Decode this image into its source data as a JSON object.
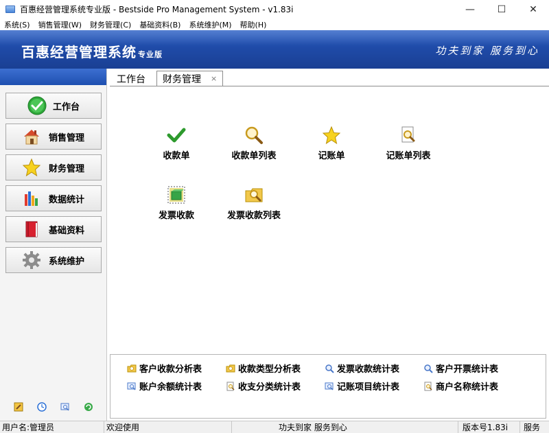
{
  "window": {
    "title": "百惠经营管理系统专业版 - Bestside Pro Management System - v1.83i",
    "minimize_glyph": "—",
    "maximize_glyph": "☐",
    "close_glyph": "✕"
  },
  "menu": [
    {
      "label": "系统(S)"
    },
    {
      "label": "销售管理(W)"
    },
    {
      "label": "财务管理(C)"
    },
    {
      "label": "基础资料(B)"
    },
    {
      "label": "系统维护(M)"
    },
    {
      "label": "帮助(H)"
    }
  ],
  "banner": {
    "brand": "百惠经营管理系统",
    "brand_sub": "专业版",
    "slogan": "功夫到家 服务到心"
  },
  "sidebar": {
    "items": [
      {
        "label": "工作台",
        "icon": "check-circle-icon",
        "active": true
      },
      {
        "label": "销售管理",
        "icon": "house-icon"
      },
      {
        "label": "财务管理",
        "icon": "star-icon"
      },
      {
        "label": "数据统计",
        "icon": "bar-chart-icon"
      },
      {
        "label": "基础资料",
        "icon": "book-icon"
      },
      {
        "label": "系统维护",
        "icon": "gear-icon"
      }
    ],
    "tools": [
      "edit-icon",
      "clock-icon",
      "search-window-icon",
      "refresh-icon"
    ]
  },
  "tabs": [
    {
      "label": "工作台"
    },
    {
      "label": "财务管理",
      "active": true,
      "close": "×"
    }
  ],
  "tiles": [
    {
      "label": "收款单",
      "icon": "checkmark-icon"
    },
    {
      "label": "收款单列表",
      "icon": "magnifier-icon"
    },
    {
      "label": "记账单",
      "icon": "star-icon"
    },
    {
      "label": "记账单列表",
      "icon": "document-search-icon"
    },
    {
      "label": "发票收款",
      "icon": "invoice-box-icon"
    },
    {
      "label": "发票收款列表",
      "icon": "folder-search-icon"
    }
  ],
  "reports": [
    {
      "label": "客户收款分析表",
      "icon": "folder-search-icon"
    },
    {
      "label": "收款类型分析表",
      "icon": "folder-search-icon"
    },
    {
      "label": "发票收款统计表",
      "icon": "magnifier-icon"
    },
    {
      "label": "客户开票统计表",
      "icon": "magnifier-icon"
    },
    {
      "label": "账户余额统计表",
      "icon": "window-search-icon"
    },
    {
      "label": "收支分类统计表",
      "icon": "document-search-icon"
    },
    {
      "label": "记账项目统计表",
      "icon": "window-search-icon"
    },
    {
      "label": "商户名称统计表",
      "icon": "document-search-icon"
    }
  ],
  "status": {
    "user": "用户名:管理员",
    "welcome": "欢迎使用",
    "slogan": "功夫到家 服务到心",
    "version": "版本号1.83i",
    "service": "服务"
  },
  "colors": {
    "banner": "#1f4ba8",
    "sidebar_top": "#2e5fc2"
  }
}
